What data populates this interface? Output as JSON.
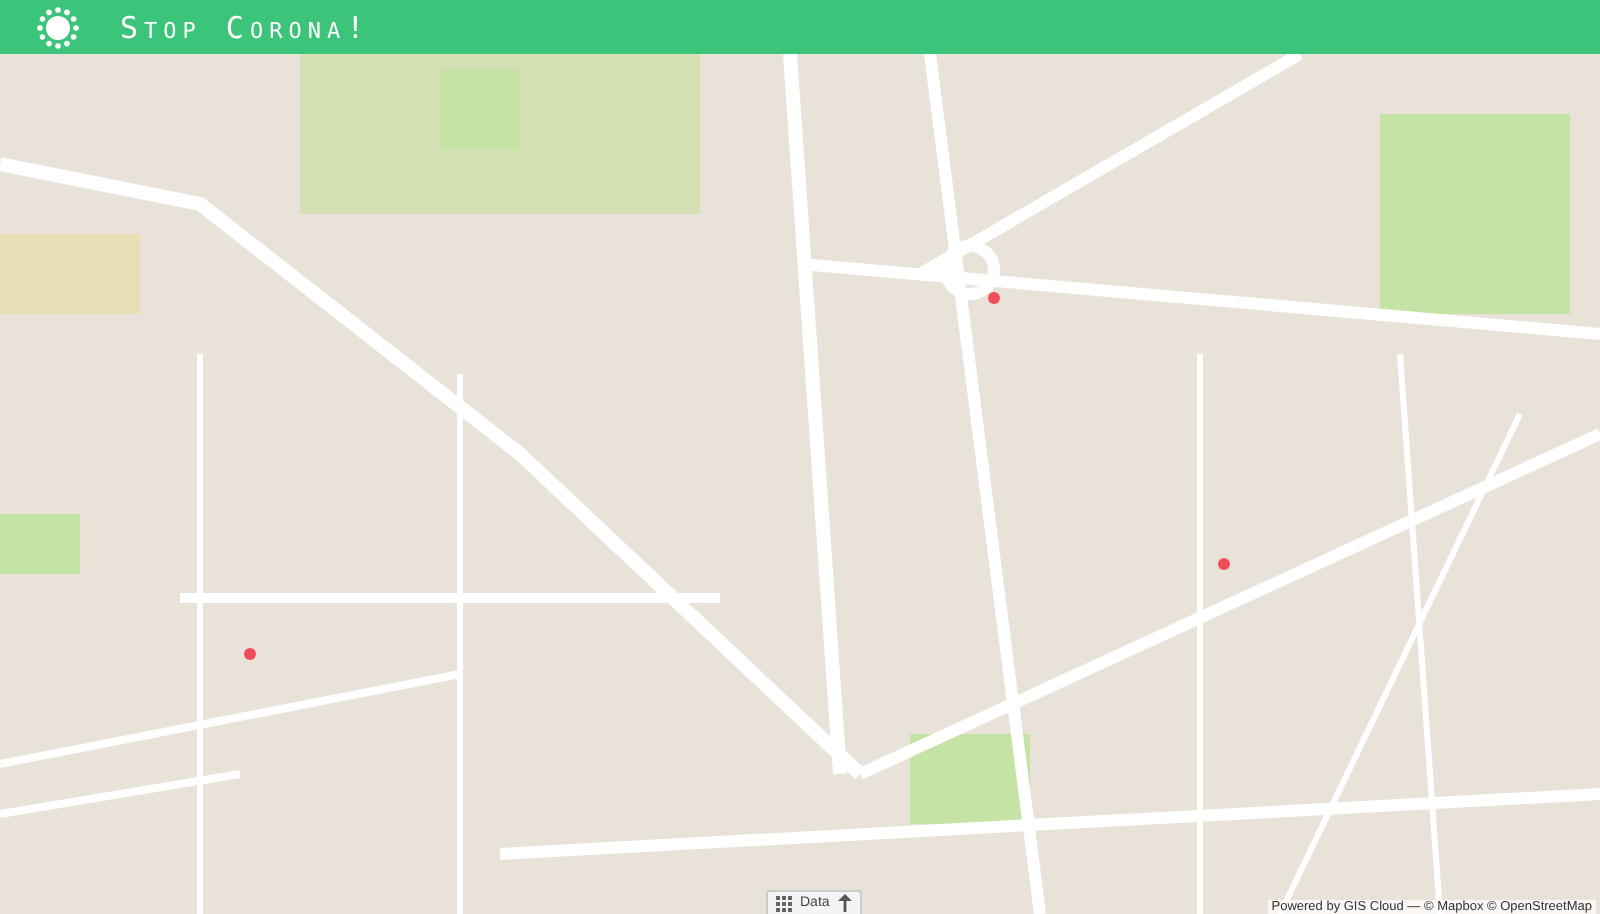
{
  "header": {
    "title": "Stop Corona!"
  },
  "map": {
    "data_button": {
      "label": "Data"
    },
    "attribution": "Powered by GIS Cloud — © Mapbox © OpenStreetMap"
  }
}
